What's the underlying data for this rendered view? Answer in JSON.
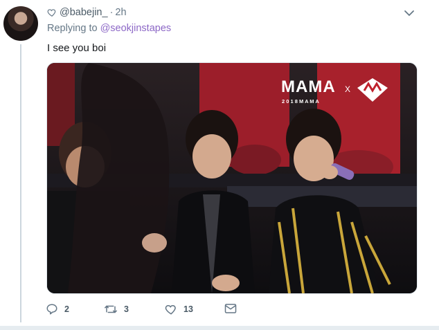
{
  "tweet": {
    "username": "@babejin_",
    "separator": "·",
    "time": "2h",
    "replying_prefix": "Replying to",
    "replying_to": "@seokjinstapes",
    "text": "I see you boi",
    "replies": "2",
    "retweets": "3",
    "likes": "13"
  },
  "media": {
    "watermark_main": "MAMA",
    "watermark_sub": "2 0 1 8  M A M A",
    "watermark_x": "X"
  },
  "icons": {
    "header_like": "heart-outline-icon",
    "caret": "chevron-down-icon",
    "reply": "reply-bubble-icon",
    "retweet": "retweet-icon",
    "like": "heart-icon",
    "message": "envelope-icon"
  },
  "colors": {
    "mention": "#8c67c6",
    "muted": "#657786",
    "thread_line": "#ccd6dd"
  }
}
